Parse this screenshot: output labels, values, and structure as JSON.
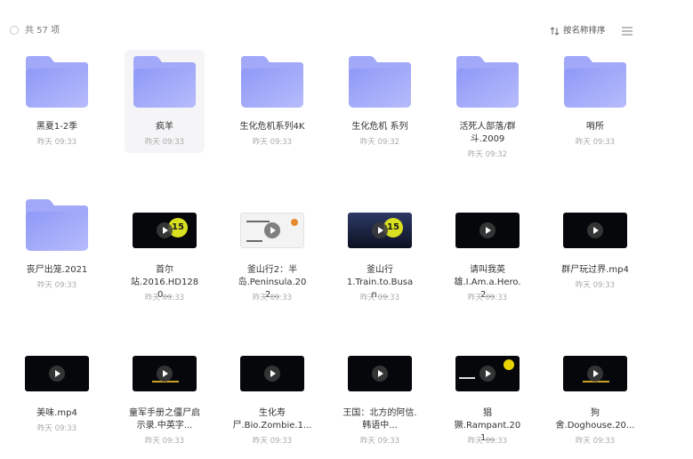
{
  "toolbar": {
    "count_label": "共 57 项",
    "sort_label": "按名称排序"
  },
  "items": [
    {
      "type": "folder",
      "name_lines": [
        "黑夏1-2季"
      ],
      "time": "昨天 09:33"
    },
    {
      "type": "folder",
      "name_lines": [
        "疯羊"
      ],
      "time": "昨天 09:33",
      "hovered": true
    },
    {
      "type": "folder",
      "name_lines": [
        "生化危机系列4K"
      ],
      "time": "昨天 09:33"
    },
    {
      "type": "folder",
      "name_lines": [
        "生化危机 系列"
      ],
      "time": "昨天 09:32"
    },
    {
      "type": "folder",
      "name_lines": [
        "活死人部落/群",
        "斗.2009"
      ],
      "time": "昨天 09:32"
    },
    {
      "type": "folder",
      "name_lines": [
        "哨所"
      ],
      "time": "昨天 09:33"
    },
    {
      "type": "folder",
      "name_lines": [
        "丧尸出笼.2021"
      ],
      "time": "昨天 09:33"
    },
    {
      "type": "video",
      "style": "num",
      "name_lines": [
        "首尔",
        "站.2016.HD1280..."
      ],
      "time": "昨天 09:33"
    },
    {
      "type": "video",
      "style": "light",
      "name_lines": [
        "釜山行2：半",
        "岛.Peninsula.202..."
      ],
      "time": "昨天 09:33"
    },
    {
      "type": "video",
      "style": "blue",
      "name_lines": [
        "釜山行",
        "1.Train.to.Busan...."
      ],
      "time": "昨天 09:33"
    },
    {
      "type": "video",
      "style": "dark",
      "name_lines": [
        "请叫我英",
        "雄.I.Am.a.Hero.2..."
      ],
      "time": "昨天 09:33"
    },
    {
      "type": "video",
      "style": "dark",
      "name_lines": [
        "群尸玩过界.mp4"
      ],
      "time": "昨天 09:33"
    },
    {
      "type": "video",
      "style": "dark",
      "name_lines": [
        "美味.mp4"
      ],
      "time": "昨天 09:33"
    },
    {
      "type": "video",
      "style": "text",
      "name_lines": [
        "童军手册之僵尸启",
        "示录.中英字..."
      ],
      "time": "昨天 09:33"
    },
    {
      "type": "video",
      "style": "dark",
      "name_lines": [
        "生化寿",
        "尸.Bio.Zombie.1..."
      ],
      "time": "昨天 09:33"
    },
    {
      "type": "video",
      "style": "dark",
      "name_lines": [
        "王国：北方的阿信.",
        "韩语中..."
      ],
      "time": "昨天 09:33"
    },
    {
      "type": "video",
      "style": "yellow",
      "name_lines": [
        "猖",
        "獗.Rampant.201..."
      ],
      "time": "昨天 09:33"
    },
    {
      "type": "video",
      "style": "text",
      "name_lines": [
        "狗",
        "舍.Doghouse.20..."
      ],
      "time": "昨天 09:33"
    }
  ]
}
